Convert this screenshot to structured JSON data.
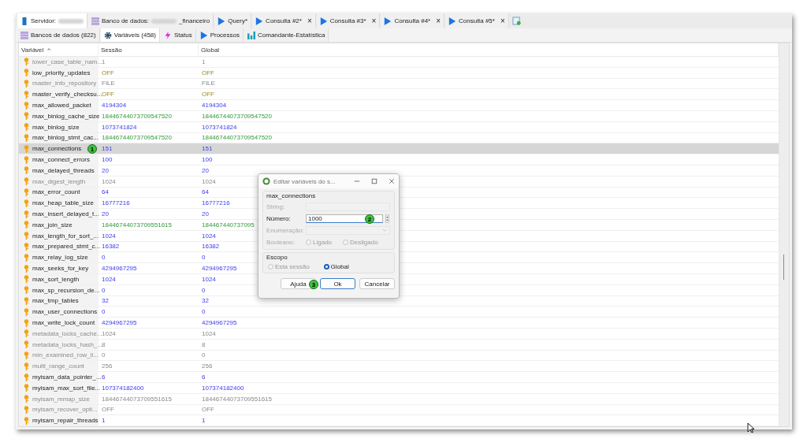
{
  "tabs": [
    {
      "kind": "server",
      "label": "Servidor:",
      "selected": true
    },
    {
      "kind": "database",
      "label": "Banco de dados:",
      "suffix": "_financeiro",
      "selected": false
    },
    {
      "kind": "query",
      "label": "Query*",
      "selected": false
    },
    {
      "kind": "query",
      "label": "Consulta #2*",
      "selected": false,
      "close": "×"
    },
    {
      "kind": "query",
      "label": "Consulta #3*",
      "selected": false,
      "close": "×"
    },
    {
      "kind": "query",
      "label": "Consulta #4*",
      "selected": false,
      "close": "×"
    },
    {
      "kind": "query",
      "label": "Consulta #5*",
      "selected": false,
      "close": "×"
    },
    {
      "kind": "new"
    }
  ],
  "subtabs": [
    {
      "kind": "databases",
      "label": "Bancos de dados (822)",
      "selected": false
    },
    {
      "kind": "variables",
      "label": "Variáveis (458)",
      "selected": true
    },
    {
      "kind": "status",
      "label": "Status",
      "selected": false
    },
    {
      "kind": "processes",
      "label": "Processos",
      "selected": false
    },
    {
      "kind": "stats",
      "label": "Comandante-Estatística",
      "selected": false
    }
  ],
  "table": {
    "columns": [
      {
        "label": "Variável",
        "sort": "^"
      },
      {
        "label": "Sessão"
      },
      {
        "label": "Global"
      }
    ],
    "rows": [
      {
        "name": "lower_case_table_nam...",
        "session": "1",
        "global": "1",
        "editable": false,
        "selected": false
      },
      {
        "name": "low_priority_updates",
        "session": "OFF",
        "global": "OFF",
        "kind": "enum",
        "editable": true,
        "selected": false
      },
      {
        "name": "master_info_repository",
        "session": "FILE",
        "global": "FILE",
        "editable": false,
        "selected": false
      },
      {
        "name": "master_verify_checksu...",
        "session": "OFF",
        "global": "OFF",
        "kind": "enum",
        "editable": true,
        "selected": false
      },
      {
        "name": "max_allowed_packet",
        "session": "4194304",
        "global": "4194304",
        "kind": "number",
        "editable": true,
        "selected": false
      },
      {
        "name": "max_binlog_cache_size",
        "session": "18446744073709547520",
        "global": "18446744073709547520",
        "kind": "large",
        "editable": true,
        "selected": false
      },
      {
        "name": "max_binlog_size",
        "session": "1073741824",
        "global": "1073741824",
        "kind": "number",
        "editable": true,
        "selected": false
      },
      {
        "name": "max_binlog_stmt_cac...",
        "session": "18446744073709547520",
        "global": "18446744073709547520",
        "kind": "large",
        "editable": true,
        "selected": false
      },
      {
        "name": "max_connections",
        "session": "151",
        "global": "151",
        "kind": "number",
        "editable": true,
        "selected": true,
        "marker": "1"
      },
      {
        "name": "max_connect_errors",
        "session": "100",
        "global": "100",
        "kind": "number",
        "editable": true,
        "selected": false
      },
      {
        "name": "max_delayed_threads",
        "session": "20",
        "global": "20",
        "kind": "number",
        "editable": true,
        "selected": false
      },
      {
        "name": "max_digest_length",
        "session": "1024",
        "global": "1024",
        "editable": false,
        "selected": false
      },
      {
        "name": "max_error_count",
        "session": "64",
        "global": "64",
        "kind": "number",
        "editable": true,
        "selected": false
      },
      {
        "name": "max_heap_table_size",
        "session": "16777216",
        "global": "16777216",
        "kind": "number",
        "editable": true,
        "selected": false
      },
      {
        "name": "max_insert_delayed_t...",
        "session": "20",
        "global": "20",
        "kind": "number",
        "editable": true,
        "selected": false
      },
      {
        "name": "max_join_size",
        "session": "18446744073709551615",
        "global": "184467440737095",
        "kind": "large",
        "editable": true,
        "selected": false
      },
      {
        "name": "max_length_for_sort_...",
        "session": "1024",
        "global": "1024",
        "kind": "number",
        "editable": true,
        "selected": false
      },
      {
        "name": "max_prepared_stmt_c...",
        "session": "16382",
        "global": "16382",
        "kind": "number",
        "editable": true,
        "selected": false
      },
      {
        "name": "max_relay_log_size",
        "session": "0",
        "global": "0",
        "kind": "number",
        "editable": true,
        "selected": false
      },
      {
        "name": "max_seeks_for_key",
        "session": "4294967295",
        "global": "4294967295",
        "kind": "number",
        "editable": true,
        "selected": false
      },
      {
        "name": "max_sort_length",
        "session": "1024",
        "global": "1024",
        "kind": "number",
        "editable": true,
        "selected": false
      },
      {
        "name": "max_sp_recursion_de...",
        "session": "0",
        "global": "0",
        "kind": "number",
        "editable": true,
        "selected": false
      },
      {
        "name": "max_tmp_tables",
        "session": "32",
        "global": "32",
        "kind": "number",
        "editable": true,
        "selected": false
      },
      {
        "name": "max_user_connections",
        "session": "0",
        "global": "0",
        "kind": "number",
        "editable": true,
        "selected": false
      },
      {
        "name": "max_write_lock_count",
        "session": "4294967295",
        "global": "4294967295",
        "kind": "number",
        "editable": true,
        "selected": false
      },
      {
        "name": "metadata_locks_cache...",
        "session": "1024",
        "global": "1024",
        "editable": false,
        "selected": false
      },
      {
        "name": "metadata_locks_hash_...",
        "session": "8",
        "global": "8",
        "editable": false,
        "selected": false
      },
      {
        "name": "min_examined_row_li...",
        "session": "0",
        "global": "0",
        "editable": false,
        "selected": false
      },
      {
        "name": "multi_range_count",
        "session": "256",
        "global": "256",
        "editable": false,
        "selected": false
      },
      {
        "name": "myisam_data_pointer_...",
        "session": "6",
        "global": "6",
        "kind": "number",
        "editable": true,
        "selected": false
      },
      {
        "name": "myisam_max_sort_file...",
        "session": "107374182400",
        "global": "107374182400",
        "kind": "number",
        "editable": true,
        "selected": false
      },
      {
        "name": "myisam_mmap_size",
        "session": "18446744073709551615",
        "global": "18446744073709551615",
        "editable": false,
        "selected": false
      },
      {
        "name": "myisam_recover_opti...",
        "session": "OFF",
        "global": "OFF",
        "editable": false,
        "selected": false
      },
      {
        "name": "myisam_repair_threads",
        "session": "1",
        "global": "1",
        "kind": "number",
        "editable": true,
        "selected": false
      }
    ]
  },
  "dialog": {
    "title": "Editar variáveis do s...",
    "group": "max_connections",
    "fields": [
      {
        "kind": "text",
        "label": "String:",
        "disabled": true
      },
      {
        "kind": "number",
        "label": "Número:",
        "value": "1000",
        "disabled": false,
        "marker": "2"
      },
      {
        "kind": "select",
        "label": "Enumeração:",
        "disabled": true
      },
      {
        "kind": "bool",
        "label": "Booleano:",
        "disabled": true,
        "options": [
          {
            "label": "Ligado",
            "selected": false
          },
          {
            "label": "Desligado",
            "selected": false
          }
        ]
      }
    ],
    "scope": {
      "label": "Escopo",
      "options": [
        {
          "label": "Esta sessão",
          "selected": false,
          "disabled": true
        },
        {
          "label": "Global",
          "selected": true,
          "disabled": false
        }
      ]
    },
    "buttons": [
      {
        "label": "Ajuda",
        "default": false,
        "marker": "3"
      },
      {
        "label": "Ok",
        "default": true
      },
      {
        "label": "Cancelar",
        "default": false
      }
    ]
  }
}
